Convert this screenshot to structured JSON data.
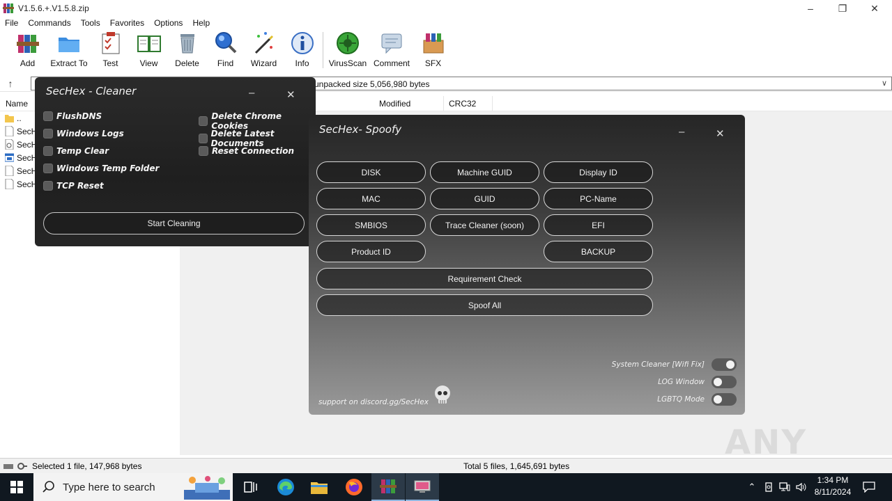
{
  "winrar": {
    "window_title": "V1.5.6.+.V1.5.8.zip",
    "menu": [
      "File",
      "Commands",
      "Tools",
      "Favorites",
      "Options",
      "Help"
    ],
    "toolbar": [
      "Add",
      "Extract To",
      "Test",
      "View",
      "Delete",
      "Find",
      "Wizard",
      "Info",
      "VirusScan",
      "Comment",
      "SFX"
    ],
    "path_text": "unpacked size 5,056,980 bytes",
    "columns": {
      "name": "Name",
      "modified": "Modified",
      "crc": "CRC32"
    },
    "files": [
      "..",
      "SecH",
      "SecH",
      "SecH",
      "SecH",
      "SecH"
    ],
    "status_left": "Selected 1 file, 147,968 bytes",
    "status_right": "Total 5 files, 1,645,691 bytes"
  },
  "cleaner": {
    "title": "SecHex - Cleaner",
    "options_left": [
      "FlushDNS",
      "Windows Logs",
      "Temp Clear",
      "Windows Temp Folder",
      "TCP Reset"
    ],
    "options_right": [
      "Delete Chrome Cookies",
      "Delete Latest Documents",
      "Reset Connection"
    ],
    "start_button": "Start Cleaning"
  },
  "spoofy": {
    "title": "SecHex- Spoofy",
    "buttons": {
      "disk": "DISK",
      "machine_guid": "Machine GUID",
      "display_id": "Display ID",
      "mac": "MAC",
      "guid": "GUID",
      "pc_name": "PC-Name",
      "smbios": "SMBIOS",
      "trace_cleaner": "Trace Cleaner (soon)",
      "efi": "EFI",
      "product_id": "Product ID",
      "backup": "BACKUP",
      "requirement_check": "Requirement Check",
      "spoof_all": "Spoof All"
    },
    "toggles": [
      {
        "label": "System Cleaner [Wifi Fix]",
        "on": true
      },
      {
        "label": "LOG Window",
        "on": false
      },
      {
        "label": "LGBTQ Mode",
        "on": false
      }
    ],
    "support_text": "support on discord.gg/SecHex"
  },
  "taskbar": {
    "search_placeholder": "Type here to search",
    "time": "1:34 PM",
    "date": "8/11/2024"
  },
  "watermark": "ANY RUN"
}
